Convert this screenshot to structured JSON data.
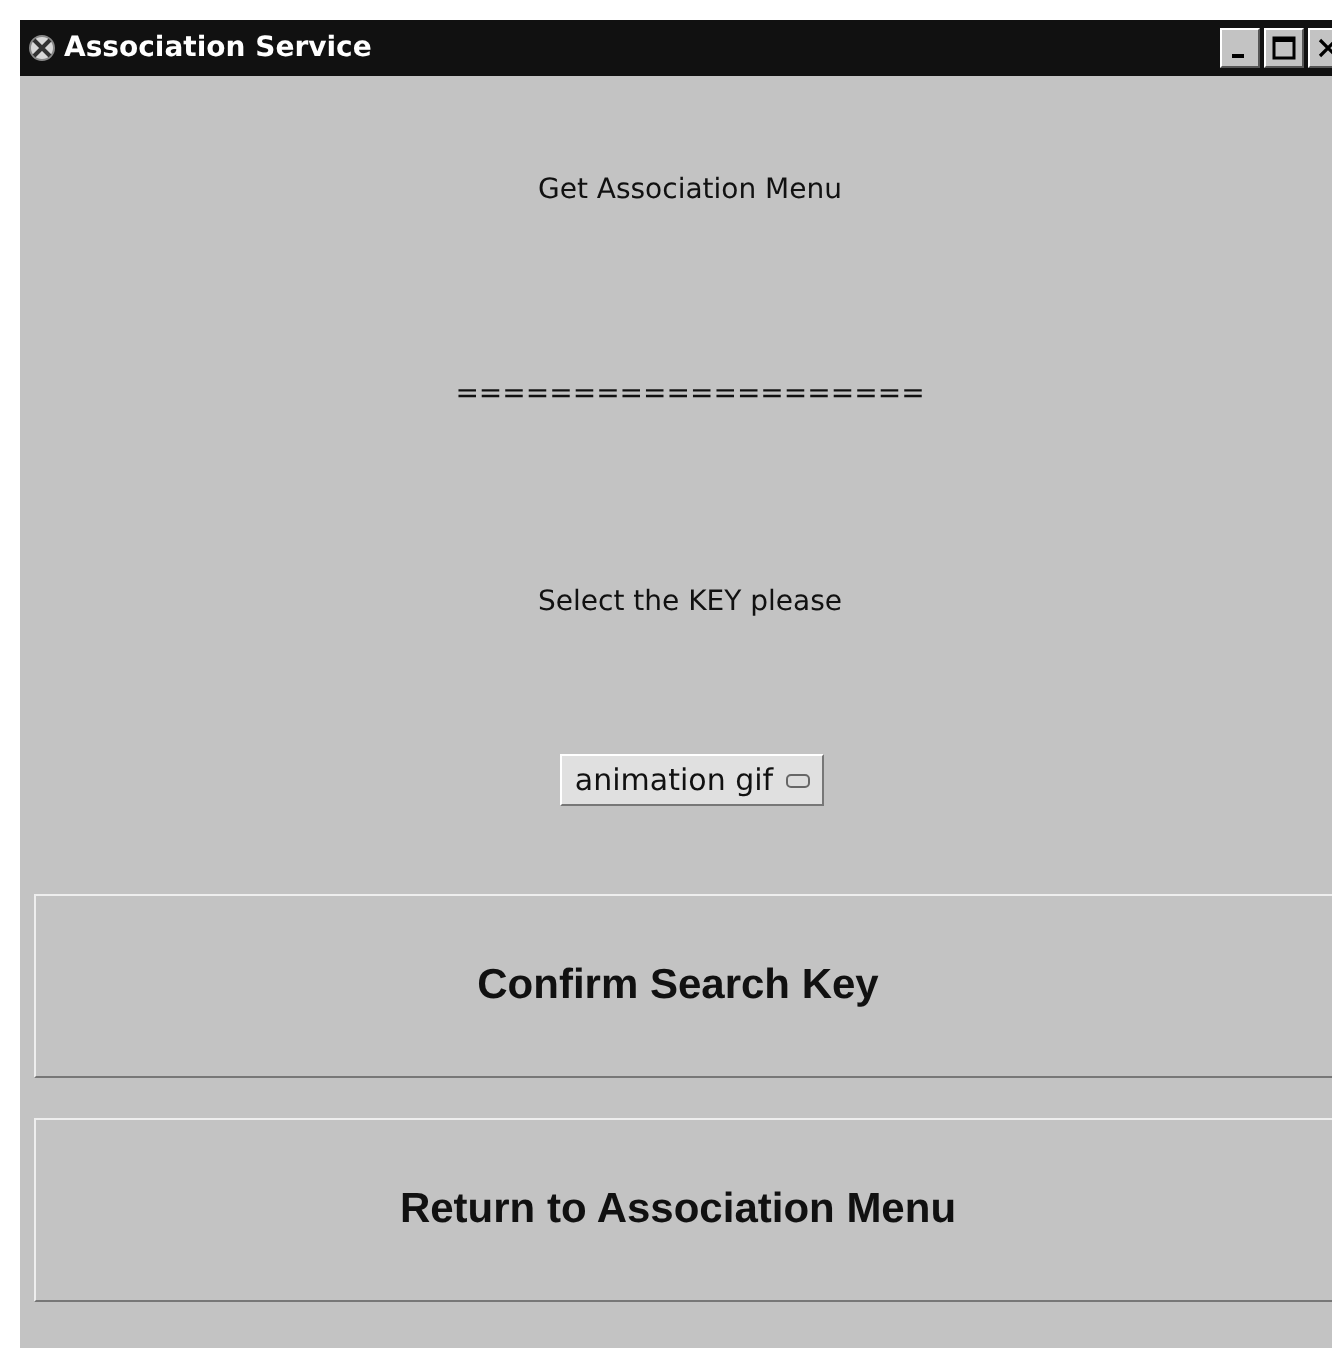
{
  "window": {
    "title": "Association Service"
  },
  "heading": "Get Association Menu",
  "separator": "====================",
  "prompt": "Select the KEY please",
  "key_choice": {
    "value": "animation gif"
  },
  "buttons": [
    "Confirm Search Key",
    "Return to Association Menu"
  ]
}
